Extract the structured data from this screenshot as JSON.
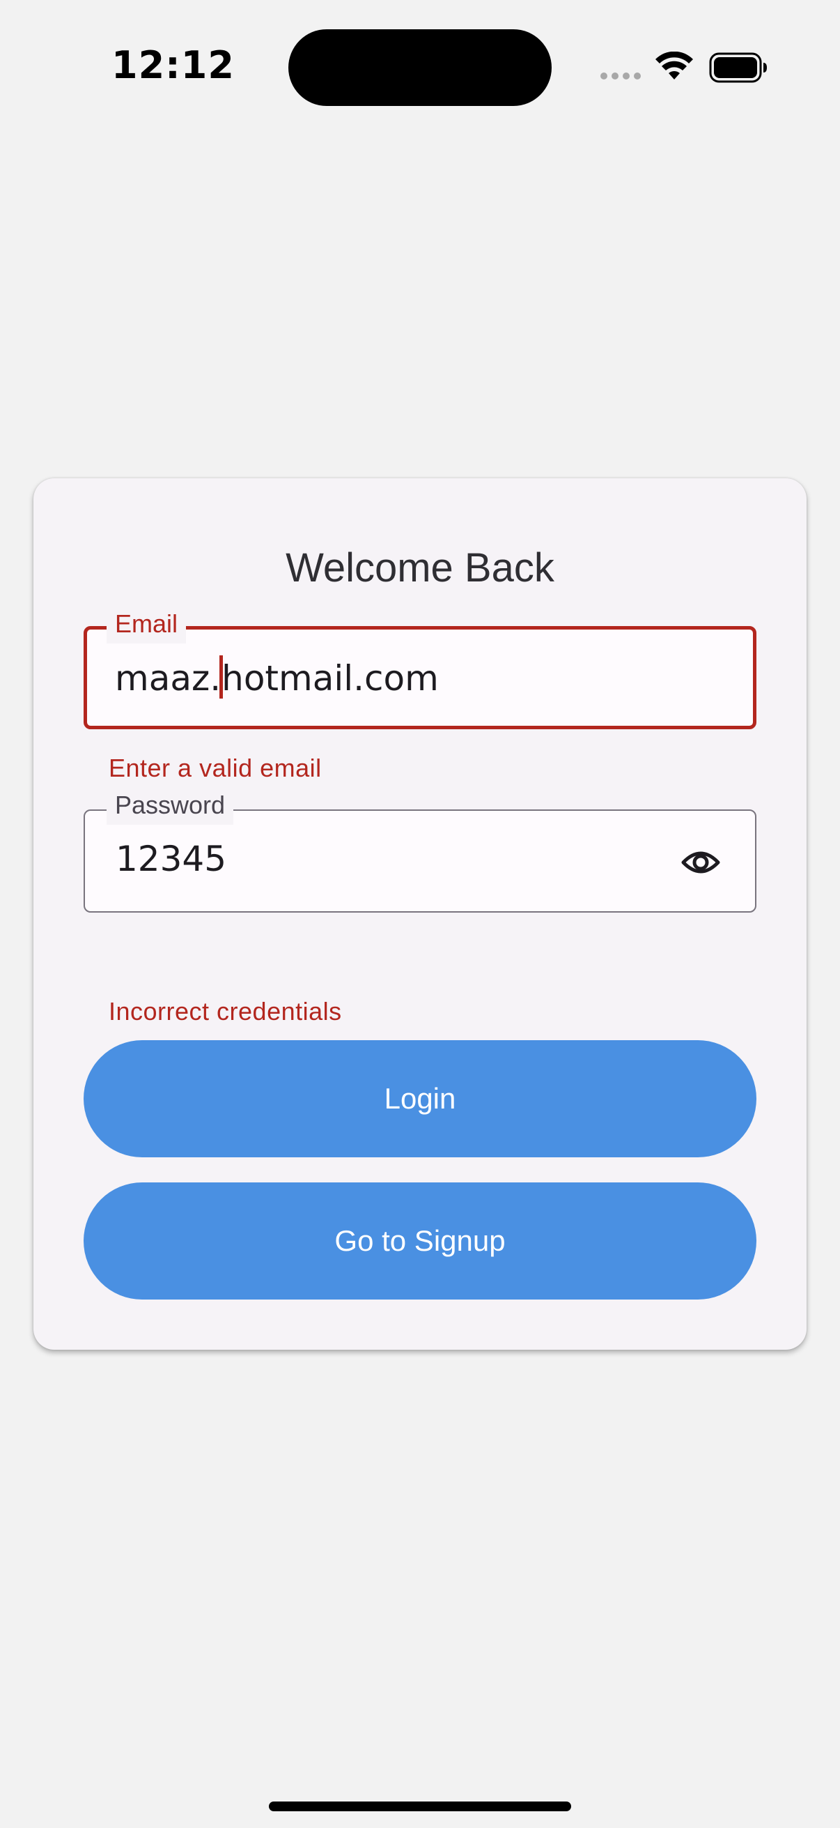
{
  "status_bar": {
    "time": "12:12",
    "icons": [
      "signal-dots-icon",
      "wifi-icon",
      "battery-icon"
    ]
  },
  "login_card": {
    "title": "Welcome Back",
    "email": {
      "label": "Email",
      "value_before_caret": "maaz.",
      "value_after_caret": "hotmail.com",
      "error": "Enter a valid email"
    },
    "password": {
      "label": "Password",
      "value": "12345",
      "toggle_icon": "eye-icon"
    },
    "form_error": "Incorrect credentials",
    "login_button": "Login",
    "signup_button": "Go to Signup"
  },
  "colors": {
    "background": "#f2f2f2",
    "card": "#f6f3f7",
    "error": "#b3261e",
    "button": "#4a90e2",
    "button_text": "#ffffff"
  }
}
